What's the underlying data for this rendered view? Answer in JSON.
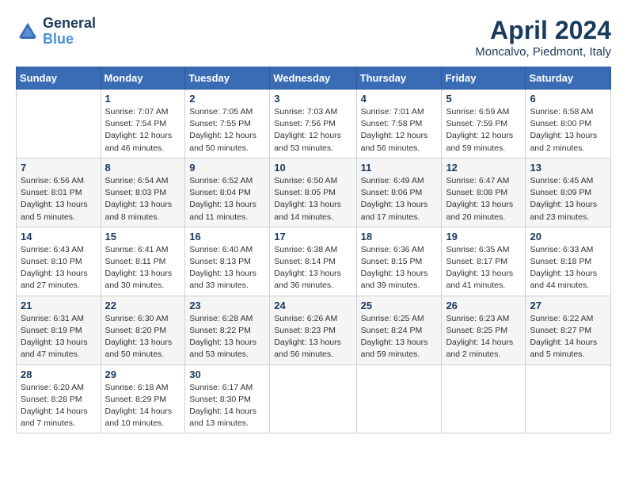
{
  "logo": {
    "line1": "General",
    "line2": "Blue"
  },
  "title": "April 2024",
  "location": "Moncalvo, Piedmont, Italy",
  "days_of_week": [
    "Sunday",
    "Monday",
    "Tuesday",
    "Wednesday",
    "Thursday",
    "Friday",
    "Saturday"
  ],
  "weeks": [
    [
      {
        "day": "",
        "sunrise": "",
        "sunset": "",
        "daylight": ""
      },
      {
        "day": "1",
        "sunrise": "Sunrise: 7:07 AM",
        "sunset": "Sunset: 7:54 PM",
        "daylight": "Daylight: 12 hours and 46 minutes."
      },
      {
        "day": "2",
        "sunrise": "Sunrise: 7:05 AM",
        "sunset": "Sunset: 7:55 PM",
        "daylight": "Daylight: 12 hours and 50 minutes."
      },
      {
        "day": "3",
        "sunrise": "Sunrise: 7:03 AM",
        "sunset": "Sunset: 7:56 PM",
        "daylight": "Daylight: 12 hours and 53 minutes."
      },
      {
        "day": "4",
        "sunrise": "Sunrise: 7:01 AM",
        "sunset": "Sunset: 7:58 PM",
        "daylight": "Daylight: 12 hours and 56 minutes."
      },
      {
        "day": "5",
        "sunrise": "Sunrise: 6:59 AM",
        "sunset": "Sunset: 7:59 PM",
        "daylight": "Daylight: 12 hours and 59 minutes."
      },
      {
        "day": "6",
        "sunrise": "Sunrise: 6:58 AM",
        "sunset": "Sunset: 8:00 PM",
        "daylight": "Daylight: 13 hours and 2 minutes."
      }
    ],
    [
      {
        "day": "7",
        "sunrise": "Sunrise: 6:56 AM",
        "sunset": "Sunset: 8:01 PM",
        "daylight": "Daylight: 13 hours and 5 minutes."
      },
      {
        "day": "8",
        "sunrise": "Sunrise: 6:54 AM",
        "sunset": "Sunset: 8:03 PM",
        "daylight": "Daylight: 13 hours and 8 minutes."
      },
      {
        "day": "9",
        "sunrise": "Sunrise: 6:52 AM",
        "sunset": "Sunset: 8:04 PM",
        "daylight": "Daylight: 13 hours and 11 minutes."
      },
      {
        "day": "10",
        "sunrise": "Sunrise: 6:50 AM",
        "sunset": "Sunset: 8:05 PM",
        "daylight": "Daylight: 13 hours and 14 minutes."
      },
      {
        "day": "11",
        "sunrise": "Sunrise: 6:49 AM",
        "sunset": "Sunset: 8:06 PM",
        "daylight": "Daylight: 13 hours and 17 minutes."
      },
      {
        "day": "12",
        "sunrise": "Sunrise: 6:47 AM",
        "sunset": "Sunset: 8:08 PM",
        "daylight": "Daylight: 13 hours and 20 minutes."
      },
      {
        "day": "13",
        "sunrise": "Sunrise: 6:45 AM",
        "sunset": "Sunset: 8:09 PM",
        "daylight": "Daylight: 13 hours and 23 minutes."
      }
    ],
    [
      {
        "day": "14",
        "sunrise": "Sunrise: 6:43 AM",
        "sunset": "Sunset: 8:10 PM",
        "daylight": "Daylight: 13 hours and 27 minutes."
      },
      {
        "day": "15",
        "sunrise": "Sunrise: 6:41 AM",
        "sunset": "Sunset: 8:11 PM",
        "daylight": "Daylight: 13 hours and 30 minutes."
      },
      {
        "day": "16",
        "sunrise": "Sunrise: 6:40 AM",
        "sunset": "Sunset: 8:13 PM",
        "daylight": "Daylight: 13 hours and 33 minutes."
      },
      {
        "day": "17",
        "sunrise": "Sunrise: 6:38 AM",
        "sunset": "Sunset: 8:14 PM",
        "daylight": "Daylight: 13 hours and 36 minutes."
      },
      {
        "day": "18",
        "sunrise": "Sunrise: 6:36 AM",
        "sunset": "Sunset: 8:15 PM",
        "daylight": "Daylight: 13 hours and 39 minutes."
      },
      {
        "day": "19",
        "sunrise": "Sunrise: 6:35 AM",
        "sunset": "Sunset: 8:17 PM",
        "daylight": "Daylight: 13 hours and 41 minutes."
      },
      {
        "day": "20",
        "sunrise": "Sunrise: 6:33 AM",
        "sunset": "Sunset: 8:18 PM",
        "daylight": "Daylight: 13 hours and 44 minutes."
      }
    ],
    [
      {
        "day": "21",
        "sunrise": "Sunrise: 6:31 AM",
        "sunset": "Sunset: 8:19 PM",
        "daylight": "Daylight: 13 hours and 47 minutes."
      },
      {
        "day": "22",
        "sunrise": "Sunrise: 6:30 AM",
        "sunset": "Sunset: 8:20 PM",
        "daylight": "Daylight: 13 hours and 50 minutes."
      },
      {
        "day": "23",
        "sunrise": "Sunrise: 6:28 AM",
        "sunset": "Sunset: 8:22 PM",
        "daylight": "Daylight: 13 hours and 53 minutes."
      },
      {
        "day": "24",
        "sunrise": "Sunrise: 6:26 AM",
        "sunset": "Sunset: 8:23 PM",
        "daylight": "Daylight: 13 hours and 56 minutes."
      },
      {
        "day": "25",
        "sunrise": "Sunrise: 6:25 AM",
        "sunset": "Sunset: 8:24 PM",
        "daylight": "Daylight: 13 hours and 59 minutes."
      },
      {
        "day": "26",
        "sunrise": "Sunrise: 6:23 AM",
        "sunset": "Sunset: 8:25 PM",
        "daylight": "Daylight: 14 hours and 2 minutes."
      },
      {
        "day": "27",
        "sunrise": "Sunrise: 6:22 AM",
        "sunset": "Sunset: 8:27 PM",
        "daylight": "Daylight: 14 hours and 5 minutes."
      }
    ],
    [
      {
        "day": "28",
        "sunrise": "Sunrise: 6:20 AM",
        "sunset": "Sunset: 8:28 PM",
        "daylight": "Daylight: 14 hours and 7 minutes."
      },
      {
        "day": "29",
        "sunrise": "Sunrise: 6:18 AM",
        "sunset": "Sunset: 8:29 PM",
        "daylight": "Daylight: 14 hours and 10 minutes."
      },
      {
        "day": "30",
        "sunrise": "Sunrise: 6:17 AM",
        "sunset": "Sunset: 8:30 PM",
        "daylight": "Daylight: 14 hours and 13 minutes."
      },
      {
        "day": "",
        "sunrise": "",
        "sunset": "",
        "daylight": ""
      },
      {
        "day": "",
        "sunrise": "",
        "sunset": "",
        "daylight": ""
      },
      {
        "day": "",
        "sunrise": "",
        "sunset": "",
        "daylight": ""
      },
      {
        "day": "",
        "sunrise": "",
        "sunset": "",
        "daylight": ""
      }
    ]
  ]
}
